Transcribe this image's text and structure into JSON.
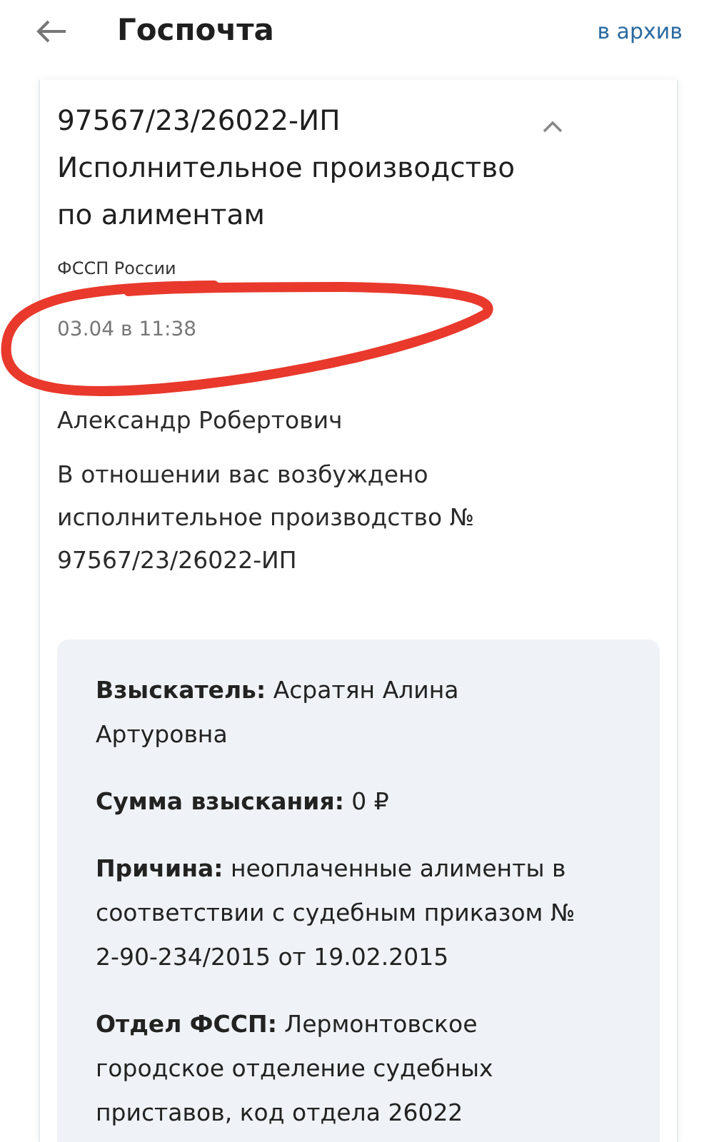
{
  "header": {
    "title": "Госпочта",
    "action": "в архив"
  },
  "message": {
    "number": "97567/23/26022-ИП",
    "subject": "Исполнительное производство по алиментам",
    "sender": "ФССП России",
    "date": "03.04 в 11:38",
    "expanded": true,
    "greeting": "Александр Робертович",
    "text": "В отношении вас возбуждено исполнительное производство № 97567/23/26022-ИП",
    "details": [
      {
        "text": "**Взыскатель:** Асратян Алина Артуровна"
      },
      {
        "text": "**Сумма взыскания:** 0 ₽"
      },
      {
        "text": "**Причина:** неоплаченные алименты в соответствии с судебным приказом № 2-90-234/2015 от 19.02.2015"
      },
      {
        "text": "**Отдел ФССП:** Лермонтовское городское отделение судебных приставов, код отдела 26022"
      }
    ]
  }
}
